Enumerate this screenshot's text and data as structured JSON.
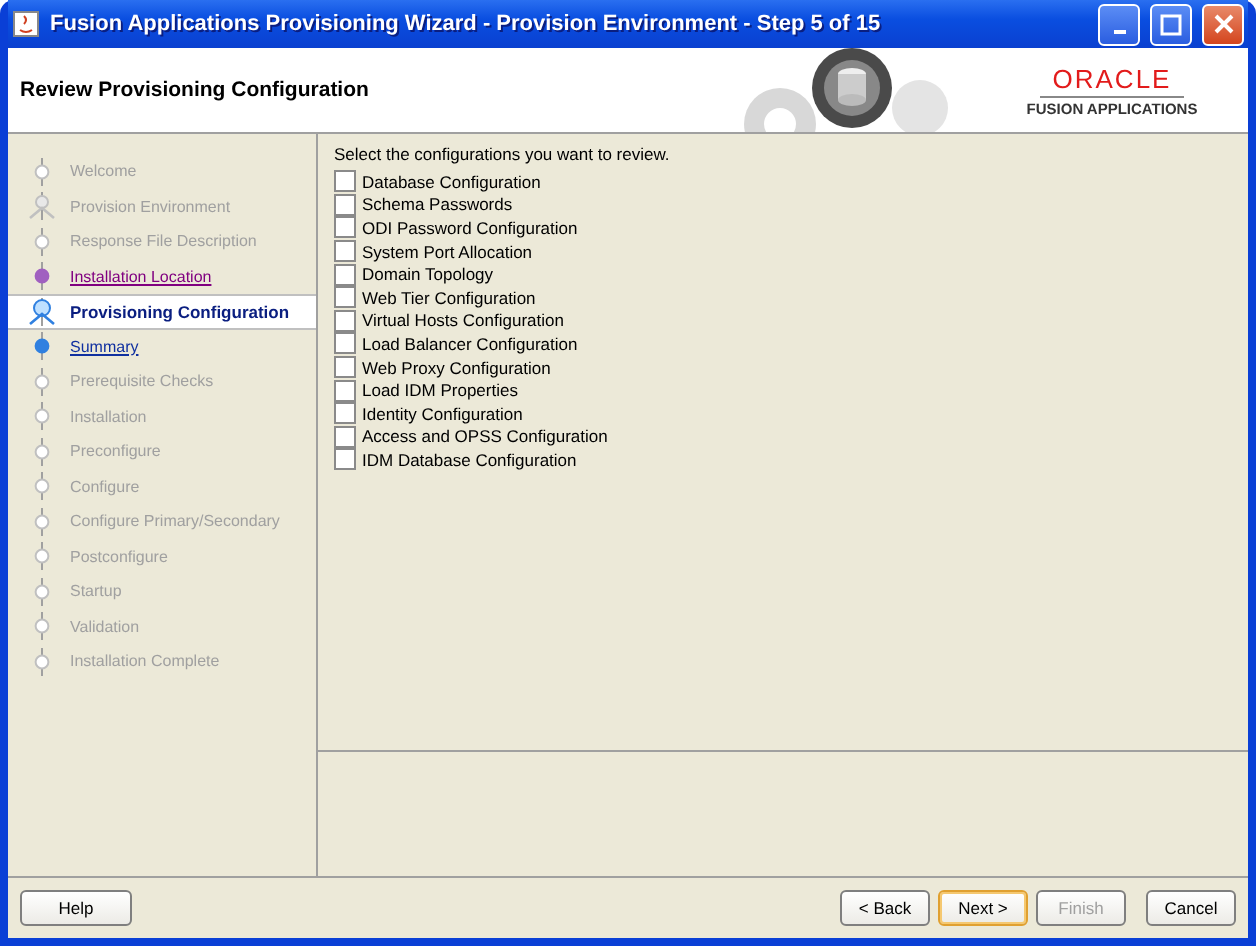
{
  "window": {
    "title": "Fusion Applications Provisioning Wizard - Provision Environment - Step 5 of 15"
  },
  "header": {
    "title": "Review Provisioning Configuration",
    "brand": "ORACLE",
    "product": "FUSION APPLICATIONS"
  },
  "steps": [
    {
      "label": "Welcome",
      "kind": "disabled",
      "selected": false
    },
    {
      "label": "Provision Environment",
      "kind": "group",
      "selected": false
    },
    {
      "label": "Response File Description",
      "kind": "disabled",
      "selected": false
    },
    {
      "label": "Installation Location",
      "kind": "visited",
      "selected": false
    },
    {
      "label": "Provisioning Configuration",
      "kind": "current",
      "selected": true
    },
    {
      "label": "Summary",
      "kind": "link",
      "selected": false
    },
    {
      "label": "Prerequisite Checks",
      "kind": "disabled",
      "selected": false
    },
    {
      "label": "Installation",
      "kind": "disabled",
      "selected": false
    },
    {
      "label": "Preconfigure",
      "kind": "disabled",
      "selected": false
    },
    {
      "label": "Configure",
      "kind": "disabled",
      "selected": false
    },
    {
      "label": "Configure Primary/Secondary",
      "kind": "disabled",
      "selected": false
    },
    {
      "label": "Postconfigure",
      "kind": "disabled",
      "selected": false
    },
    {
      "label": "Startup",
      "kind": "disabled",
      "selected": false
    },
    {
      "label": "Validation",
      "kind": "disabled",
      "selected": false
    },
    {
      "label": "Installation Complete",
      "kind": "disabled",
      "selected": false
    }
  ],
  "content": {
    "prompt": "Select the configurations you want to review.",
    "options": [
      {
        "label": "Database Configuration",
        "checked": false
      },
      {
        "label": "Schema Passwords",
        "checked": false
      },
      {
        "label": "ODI Password Configuration",
        "checked": false
      },
      {
        "label": "System Port Allocation",
        "checked": false
      },
      {
        "label": "Domain Topology",
        "checked": false
      },
      {
        "label": "Web Tier Configuration",
        "checked": false
      },
      {
        "label": "Virtual Hosts Configuration",
        "checked": false
      },
      {
        "label": "Load Balancer Configuration",
        "checked": false
      },
      {
        "label": "Web Proxy Configuration",
        "checked": false
      },
      {
        "label": "Load IDM Properties",
        "checked": false
      },
      {
        "label": "Identity Configuration",
        "checked": false
      },
      {
        "label": "Access and OPSS Configuration",
        "checked": false
      },
      {
        "label": "IDM Database Configuration",
        "checked": false
      }
    ]
  },
  "help_button": {
    "label": "Help"
  },
  "nav_buttons": [
    {
      "label": "< Back",
      "disabled": false,
      "default": false
    },
    {
      "label": "Next >",
      "disabled": false,
      "default": true
    },
    {
      "label": "Finish",
      "disabled": true,
      "default": false
    },
    {
      "label": "Cancel",
      "disabled": false,
      "default": false
    }
  ]
}
